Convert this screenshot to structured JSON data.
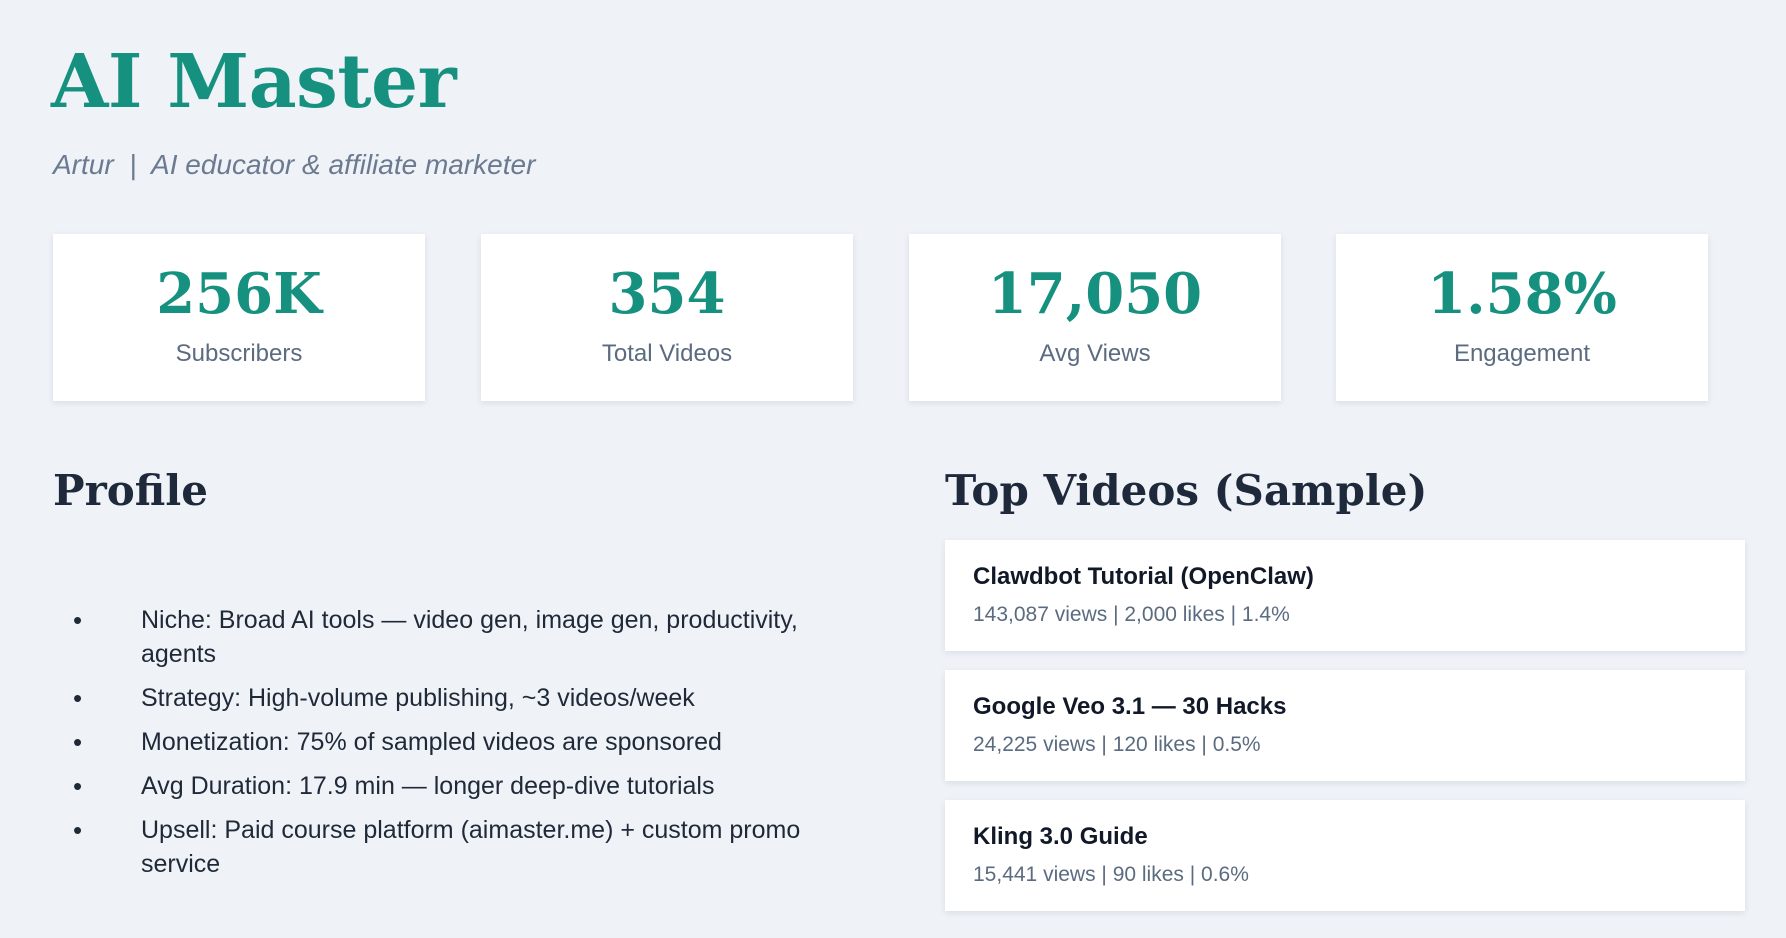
{
  "header": {
    "title": "AI Master",
    "subtitle": "Artur  |  AI educator & affiliate marketer"
  },
  "stats": [
    {
      "value": "256K",
      "label": "Subscribers"
    },
    {
      "value": "354",
      "label": "Total Videos"
    },
    {
      "value": "17,050",
      "label": "Avg Views"
    },
    {
      "value": "1.58%",
      "label": "Engagement"
    }
  ],
  "profile": {
    "title": "Profile",
    "items": [
      "Niche: Broad AI tools — video gen, image gen, productivity, agents",
      "Strategy: High-volume publishing, ~3 videos/week",
      "Monetization: 75% of sampled videos are sponsored",
      "Avg Duration: 17.9 min — longer deep-dive tutorials",
      "Upsell: Paid course platform (aimaster.me) + custom promo service"
    ]
  },
  "top_videos": {
    "title": "Top Videos (Sample)",
    "items": [
      {
        "title": "Clawdbot Tutorial (OpenClaw)",
        "meta": "143,087 views  |  2,000 likes  |  1.4%"
      },
      {
        "title": "Google Veo 3.1 — 30 Hacks",
        "meta": "24,225 views  |  120 likes  |  0.5%"
      },
      {
        "title": "Kling 3.0 Guide",
        "meta": "15,441 views  |  90 likes  |  0.6%"
      }
    ]
  },
  "colors": {
    "accent": "#16917f",
    "background": "#eff3f8",
    "heading": "#1e293b",
    "muted": "#5b6b80"
  }
}
